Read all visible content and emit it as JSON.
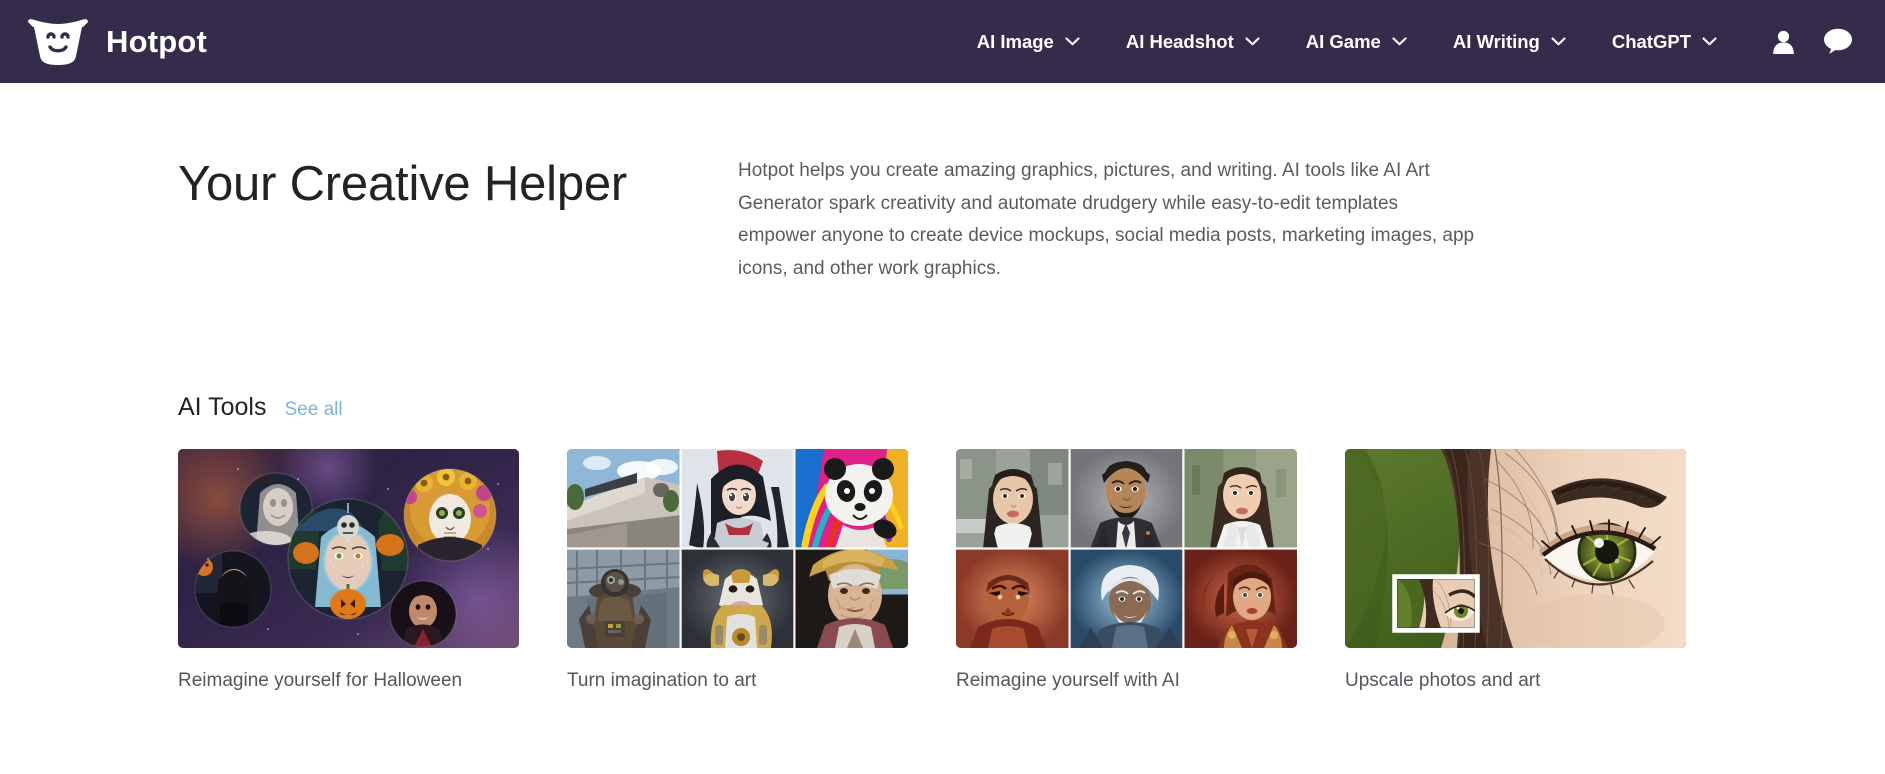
{
  "header": {
    "brand": "Hotpot",
    "logo_icon": "hotpot-smiley-pot-logo",
    "nav": [
      {
        "label": "AI Image",
        "icon": "chevron-down-icon"
      },
      {
        "label": "AI Headshot",
        "icon": "chevron-down-icon"
      },
      {
        "label": "AI Game",
        "icon": "chevron-down-icon"
      },
      {
        "label": "AI Writing",
        "icon": "chevron-down-icon"
      },
      {
        "label": "ChatGPT",
        "icon": "chevron-down-icon"
      }
    ],
    "icons": [
      {
        "name": "user-account-icon"
      },
      {
        "name": "chat-bubble-icon"
      }
    ],
    "background_color": "#352b4b",
    "text_color": "#ffffff"
  },
  "hero": {
    "title": "Your Creative Helper",
    "description": "Hotpot helps you create amazing graphics, pictures, and writing. AI tools like AI Art Generator spark creativity and automate drudgery while easy-to-edit templates empower anyone to create device mockups, social media posts, marketing images, app icons, and other work graphics."
  },
  "section": {
    "title": "AI Tools",
    "see_all": "See all",
    "see_all_color": "#7eb3e0"
  },
  "cards": [
    {
      "caption": "Reimagine yourself for Halloween",
      "thumb": "halloween-portrait-collage"
    },
    {
      "caption": "Turn imagination to art",
      "thumb": "ai-art-grid"
    },
    {
      "caption": "Reimagine yourself with AI",
      "thumb": "headshot-grid"
    },
    {
      "caption": "Upscale photos and art",
      "thumb": "eye-closeup-upscale"
    }
  ]
}
